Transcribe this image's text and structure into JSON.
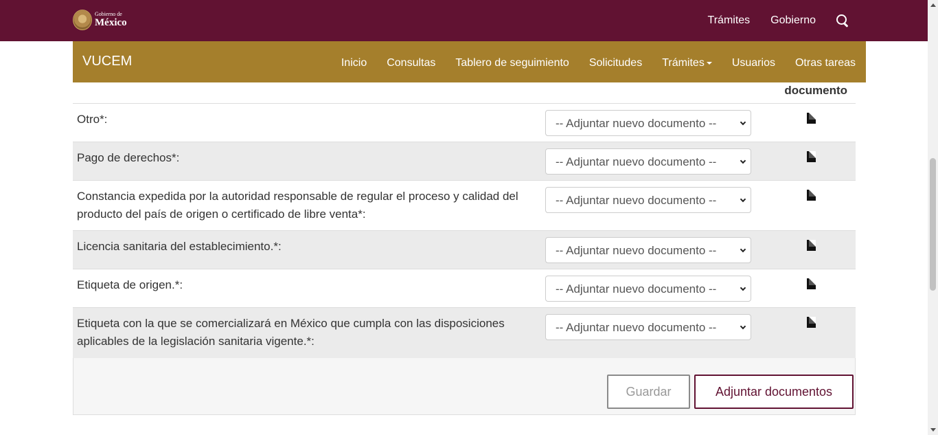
{
  "gov_header": {
    "logo_small": "Gobierno de",
    "logo_big": "México",
    "nav": [
      "Trámites",
      "Gobierno"
    ],
    "search_icon": "search-icon",
    "bg_color": "#611232"
  },
  "vucem_nav": {
    "brand": "VUCEM",
    "items": [
      "Inicio",
      "Consultas",
      "Tablero de seguimiento",
      "Solicitudes",
      "Trámites",
      "Usuarios",
      "Otras tareas"
    ],
    "bg_color": "#a57f2c"
  },
  "table": {
    "column_header": "documento",
    "select_placeholder": "-- Adjuntar nuevo documento --",
    "rows": [
      {
        "label": "Otro",
        "required": "*:"
      },
      {
        "label": "Pago de derechos",
        "required": "*:"
      },
      {
        "label": "Constancia expedida por la autoridad responsable de regular el proceso y calidad del producto del país de origen o certificado de libre venta",
        "required": "*:"
      },
      {
        "label": "Licencia sanitaria del establecimiento.",
        "required": "*:"
      },
      {
        "label": "Etiqueta de origen.",
        "required": "*:"
      },
      {
        "label": "Etiqueta con la que se comercializará en México que cumpla con las disposiciones aplicables de la legislación sanitaria vigente.",
        "required": "*:"
      }
    ],
    "doc_icon": "file-icon"
  },
  "footer": {
    "save_label": "Guardar",
    "attach_label": "Adjuntar documentos"
  }
}
